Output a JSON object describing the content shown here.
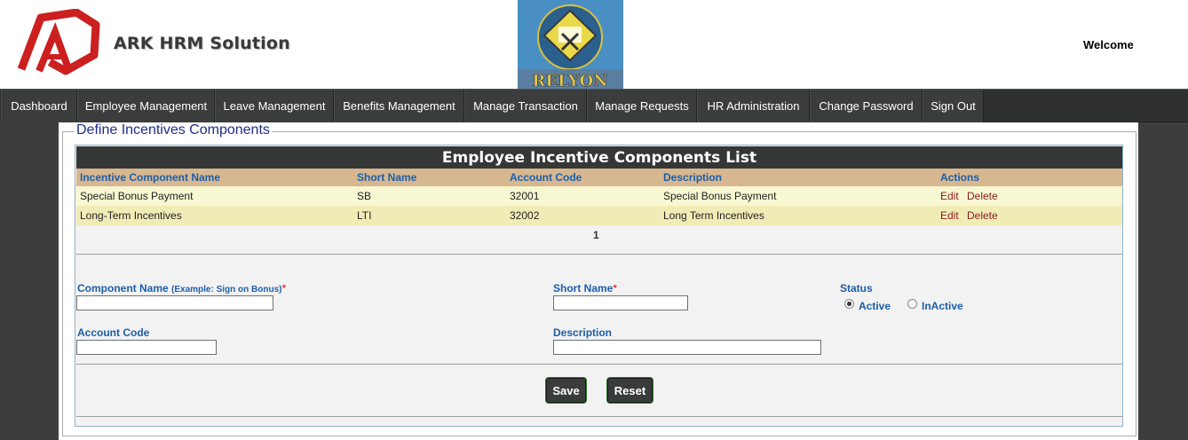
{
  "header": {
    "brand_name": "ARK HRM Solution",
    "center_logo_text": "RELYON",
    "welcome": "Welcome"
  },
  "nav": [
    {
      "label": "Dashboard"
    },
    {
      "label": "Employee Management"
    },
    {
      "label": "Leave Management"
    },
    {
      "label": "Benefits Management"
    },
    {
      "label": "Manage Transaction"
    },
    {
      "label": "Manage Requests"
    },
    {
      "label": "HR Administration"
    },
    {
      "label": "Change Password"
    },
    {
      "label": "Sign Out"
    }
  ],
  "section": {
    "legend": "Define Incentives Components"
  },
  "grid": {
    "title": "Employee Incentive Components List",
    "columns": [
      "Incentive Component Name",
      "Short Name",
      "Account Code",
      "Description",
      "Actions"
    ],
    "rows": [
      {
        "name": "Special Bonus Payment",
        "short": "SB",
        "code": "32001",
        "description": "Special Bonus Payment",
        "edit": "Edit",
        "delete": "Delete"
      },
      {
        "name": "Long-Term Incentives",
        "short": "LTI",
        "code": "32002",
        "description": "Long Term Incentives",
        "edit": "Edit",
        "delete": "Delete"
      }
    ],
    "page": "1"
  },
  "form": {
    "component_name_label": "Component Name",
    "component_name_hint": "(Example: Sign on Bonus)",
    "required_mark": "*",
    "component_name_value": "",
    "short_name_label": "Short Name",
    "short_name_value": "",
    "status_label": "Status",
    "status_active": "Active",
    "status_inactive": "InActive",
    "status_selected": "Active",
    "account_code_label": "Account Code",
    "account_code_value": "",
    "description_label": "Description",
    "description_value": "",
    "save_label": "Save",
    "reset_label": "Reset"
  },
  "colors": {
    "navbar": "#2f3131",
    "grid_header": "#d7b790",
    "row_odd": "#f7f7d2",
    "row_even": "#f1ecb6",
    "label_blue": "#1c5ea8",
    "action_red": "#8a1c1c"
  }
}
